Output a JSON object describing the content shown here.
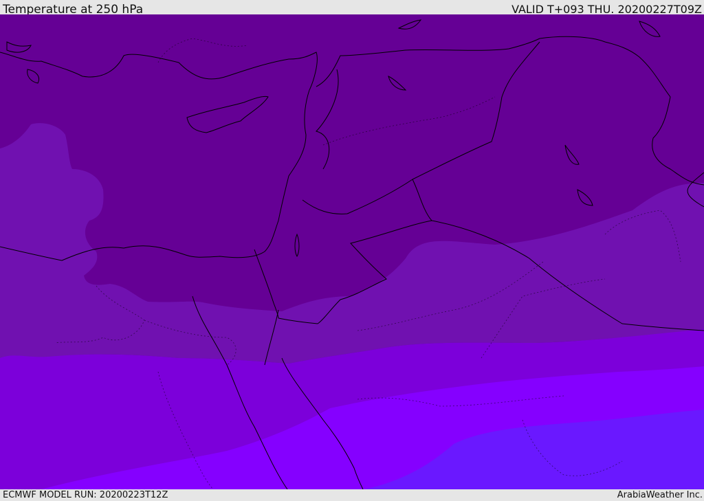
{
  "header": {
    "title": "Temperature at 250 hPa",
    "valid_time": "VALID T+093 THU. 20200227T09Z"
  },
  "footer": {
    "model_run": "ECMWF MODEL RUN: 20200223T12Z",
    "credit": "ArabiaWeather Inc."
  },
  "colors": {
    "band_coldest": "#650095",
    "band_2": "#7011b0",
    "band_3": "#7c00da",
    "band_4": "#8500ff",
    "band_warmest": "#6a18ff",
    "coastline": "#000000"
  }
}
